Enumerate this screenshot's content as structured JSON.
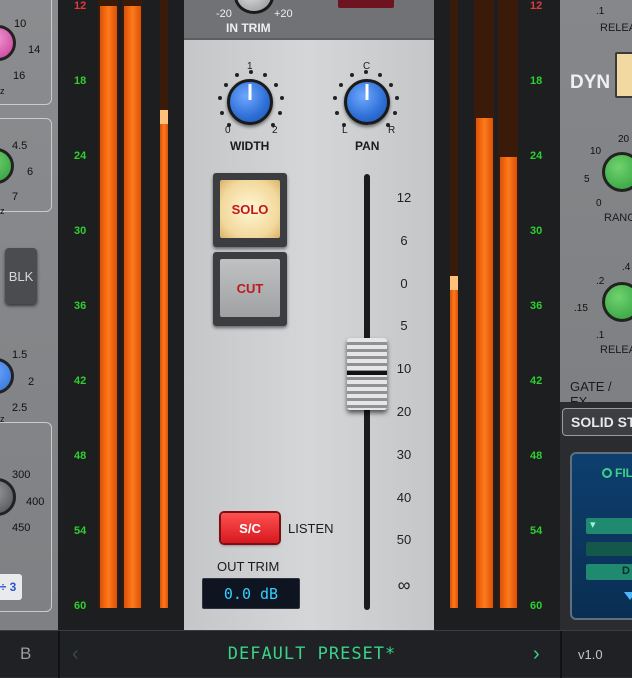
{
  "left_panel": {
    "knob1_labels": [
      "10",
      "14",
      "16"
    ],
    "knob2_labels": [
      "4.5",
      "6",
      "7"
    ],
    "knob3_labels": [
      "1.5",
      "2",
      "2.5"
    ],
    "knob4_labels": [
      "300",
      "400",
      "450"
    ],
    "blk_label": "BLK",
    "small_btn": "÷ 3",
    "corner_letters": [
      "z",
      "z",
      "z"
    ]
  },
  "meter_left": {
    "ticks": [
      "12",
      "18",
      "24",
      "30",
      "36",
      "42",
      "48",
      "54",
      "60"
    ],
    "levels": [
      1.0,
      1.0
    ],
    "peak_hold": 0.82
  },
  "center": {
    "in_trim": {
      "label": "IN TRIM",
      "min": "-20",
      "max": "+20"
    },
    "width": {
      "label": "WIDTH",
      "top": "1",
      "left": "0",
      "right": "2"
    },
    "pan": {
      "label": "PAN",
      "top": "C",
      "left": "L",
      "right": "R"
    },
    "solo_label": "SOLO",
    "cut_label": "CUT",
    "fader_scale": [
      "12",
      "6",
      "0",
      "5",
      "10",
      "20",
      "30",
      "40",
      "50",
      "∞"
    ],
    "fader_value_db": -10,
    "sc_label": "S/C",
    "listen_label": "LISTEN",
    "out_trim_label": "OUT TRIM",
    "out_trim_value": "0.0 dB"
  },
  "meter_right": {
    "ticks": [
      "12",
      "18",
      "24",
      "30",
      "36",
      "42",
      "48",
      "54",
      "60"
    ],
    "levels": [
      0.55,
      0.8,
      0.76
    ]
  },
  "right_panel": {
    "release_label": "RELEA",
    "release_value": ".1",
    "dyn_label": "DYN",
    "range_labels": [
      "10",
      "5",
      "0",
      "20"
    ],
    "range_label": "RANG",
    "release2_labels": [
      ".2",
      ".4",
      ".15",
      ".1"
    ],
    "release2_label": "RELEA",
    "gate_label": "GATE / EX",
    "solid_label": "SOLID ST",
    "fil_label": "FIL",
    "dropdown_1": "▾",
    "dropdown_2": "D"
  },
  "bottom_bar": {
    "left_letter": "B",
    "preset_name": "DEFAULT PRESET*",
    "prev_icon": "‹",
    "next_icon": "›",
    "version": "v1.0"
  },
  "colors": {
    "meter_fill": "#ff7a1a",
    "tick_green": "#2ecf2e",
    "tick_red": "#e23b3b",
    "preset_green": "#3ad38a",
    "knob_blue": "#2e6fd6",
    "knob_green": "#2f9a3a"
  }
}
